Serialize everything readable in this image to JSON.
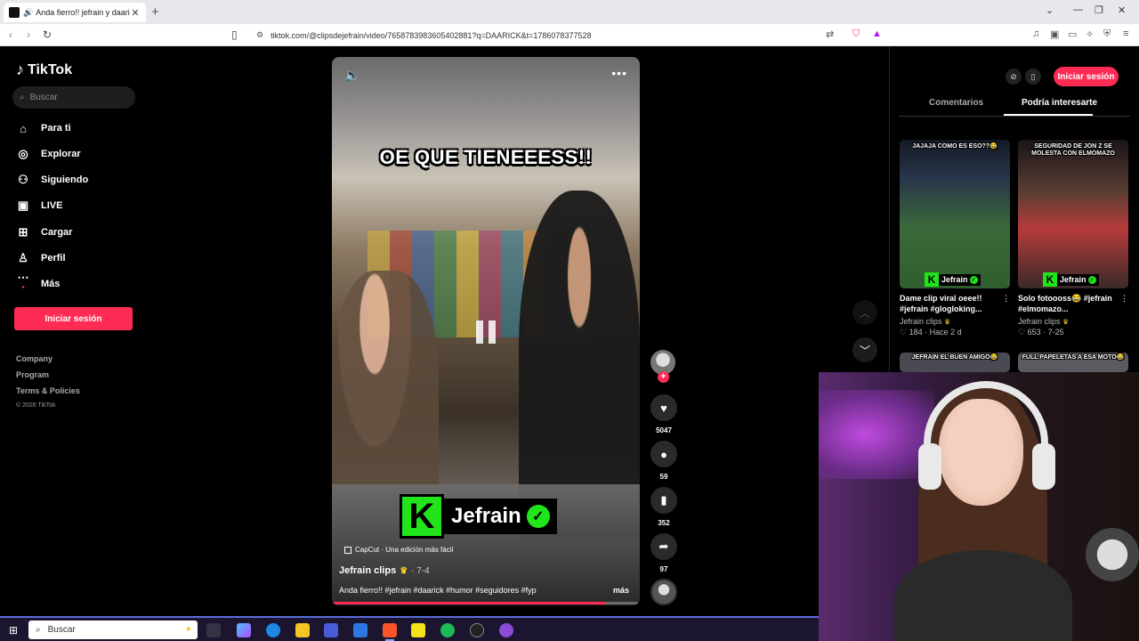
{
  "browser": {
    "tab_title": "Anda fierro!! jefrain y daarick",
    "url": "tiktok.com/@clipsdejefrain/video/7658783983605402881?q=DAARICK&t=1786078377528"
  },
  "sidebar": {
    "brand": "TikTok",
    "search_placeholder": "Buscar",
    "items": [
      {
        "label": "Para ti",
        "icon": "home-icon"
      },
      {
        "label": "Explorar",
        "icon": "compass-icon"
      },
      {
        "label": "Siguiendo",
        "icon": "following-icon"
      },
      {
        "label": "LIVE",
        "icon": "live-icon"
      },
      {
        "label": "Cargar",
        "icon": "upload-icon"
      },
      {
        "label": "Perfil",
        "icon": "profile-icon"
      },
      {
        "label": "Más",
        "icon": "more-icon"
      }
    ],
    "login_label": "Iniciar sesión",
    "footer_links": [
      "Company",
      "Program",
      "Terms & Policies"
    ],
    "copyright": "© 2026 TikTok"
  },
  "video": {
    "top_caption": "OE QUE TIENEEESS!!",
    "brand_name": "Jefrain",
    "capcut_label": "CapCut · Una edición más fácil",
    "author": "Jefrain clips",
    "date": "· 7-4",
    "description": "Anda fierro!! #jefrain #daarick #humor #seguidores #fyp",
    "more_label": "más",
    "progress": 0.89
  },
  "actions": {
    "likes": "5047",
    "comments": "59",
    "saves": "352",
    "shares": "97"
  },
  "right_panel": {
    "login_label": "Iniciar sesión",
    "tabs": [
      "Comentarios",
      "Podría interesarte"
    ],
    "active_tab": "Podría interesarte",
    "cards": [
      {
        "thumb_text": "JAJAJA COMO ES ESO??😂",
        "title": "Dame clip viral oeee!! #jefrain #glogloking...",
        "author": "Jefrain clips",
        "meta": "♡ 184 · Hace 2 d",
        "tag": "Jefrain"
      },
      {
        "thumb_text": "SEGURIDAD DE JON Z SE MOLESTA CON ELMOMAZO",
        "title": "Solo fotoooss😂 #jefrain #elmomazo...",
        "author": "Jefrain clips",
        "meta": "♡ 653 · 7-25",
        "tag": "Jefrain"
      },
      {
        "thumb_text": "JEFRAIN EL BUEN AMIGO😂",
        "title": "",
        "author": "",
        "meta": "",
        "tag": ""
      },
      {
        "thumb_text": "FULL PAPELETAS A ESA MOTO😂",
        "title": "",
        "author": "",
        "meta": "",
        "tag": ""
      }
    ]
  },
  "taskbar": {
    "search_label": "Buscar"
  },
  "colors": {
    "accent": "#fe2c55",
    "brand_green": "#21e51a"
  }
}
